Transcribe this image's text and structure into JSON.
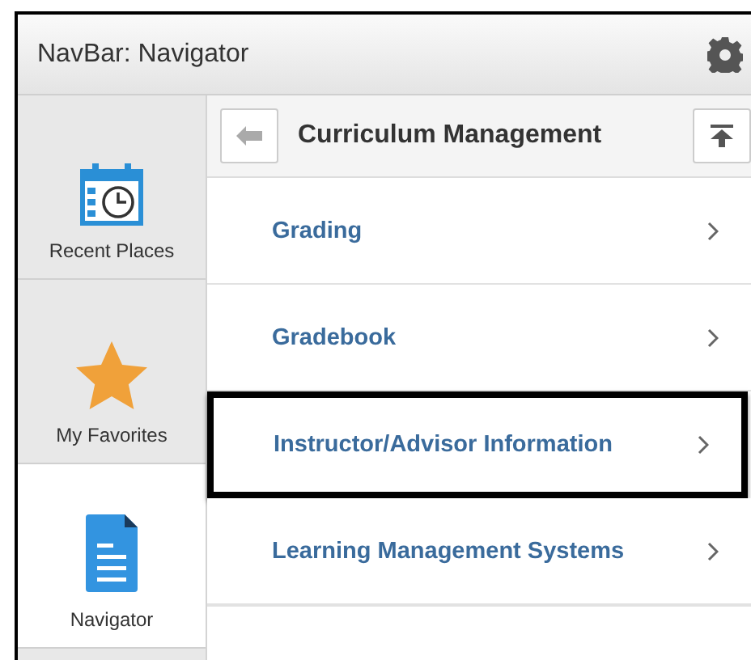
{
  "window": {
    "title": "NavBar: Navigator"
  },
  "sidebar": {
    "items": [
      {
        "kind": "calendar",
        "label": "Recent Places",
        "selected": false
      },
      {
        "kind": "star",
        "label": "My Favorites",
        "selected": false
      },
      {
        "kind": "document",
        "label": "Navigator",
        "selected": true
      }
    ]
  },
  "content": {
    "title": "Curriculum Management",
    "items": [
      {
        "label": "Grading",
        "highlighted": false
      },
      {
        "label": "Gradebook",
        "highlighted": false
      },
      {
        "label": "Instructor/Advisor Information",
        "highlighted": true
      },
      {
        "label": "Learning Management Systems",
        "highlighted": false
      }
    ]
  }
}
